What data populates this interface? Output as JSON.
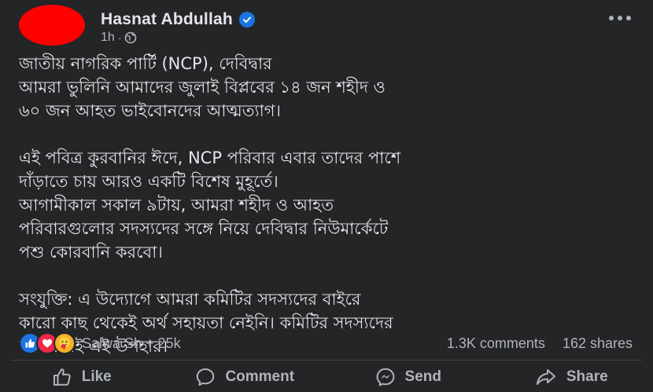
{
  "post": {
    "author": {
      "name": "Hasnat Abdullah",
      "verified_icon": "verified-badge-icon"
    },
    "time": "1h",
    "audience_icon": "globe-icon",
    "text": {
      "p1": [
        "জাতীয় নাগরিক পার্টি (NCP), দেবিদ্বার",
        "আমরা ভুলিনি আমাদের জুলাই বিপ্লবের ১৪ জন শহীদ ও",
        "৬০ জন আহত ভাইবোনদের আত্মত্যাগ।"
      ],
      "p2": [
        "এই পবিত্র কুরবানির ঈদে, NCP পরিবার এবার তাদের পাশে",
        "দাঁড়াতে চায় আরও একটি বিশেষ মুহূর্তে।",
        "আগামীকাল সকাল ৯টায়, আমরা শহীদ ও আহত",
        "পরিবারগুলোর সদস্যদের সঙ্গে নিয়ে দেবিদ্বার নিউমার্কেটে",
        "পশু কোরবানি করবো।"
      ],
      "p3": [
        "সংযুক্তি: এ উদ্যোগে আমরা কমিটির সদস্যদের বাইরে",
        "কারো কাছ থেকেই অর্থ সহায়তা নেইনি। কমিটির সদস্যদের",
        "অর্থায়নেই এই উপহার।"
      ]
    },
    "reactions": {
      "icons": [
        "like-icon",
        "love-icon",
        "care-icon"
      ],
      "summary": "Salwa Sh + 25k",
      "comments": "1.3K comments",
      "shares": "162 shares"
    },
    "actions": {
      "like": "Like",
      "comment": "Comment",
      "send": "Send",
      "share": "Share"
    }
  },
  "colors": {
    "background": "#242526",
    "text_primary": "#e4e6eb",
    "text_secondary": "#b0b3b8",
    "accent_blue": "#1b74e4",
    "avatar": "#ff0000"
  }
}
